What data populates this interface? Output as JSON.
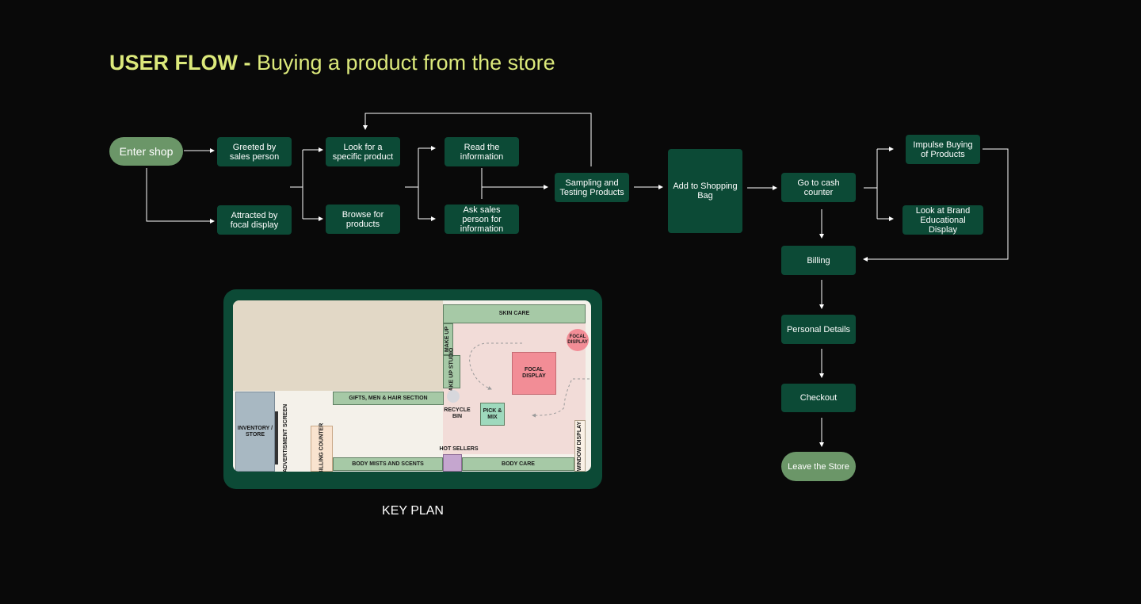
{
  "title": {
    "bold": "USER FLOW -",
    "rest": " Buying a product from the store"
  },
  "nodes": {
    "enter_shop": "Enter shop",
    "greeted": "Greeted by sales person",
    "attracted": "Attracted by focal display",
    "look_specific": "Look for a specific product",
    "browse": "Browse for products",
    "read_info": "Read the information",
    "ask_sales": "Ask sales person for information",
    "sampling": "Sampling and Testing Products",
    "add_bag": "Add to Shopping Bag",
    "cash_counter": "Go to cash counter",
    "impulse": "Impulse Buying of Products",
    "brand_display": "Look at Brand Educational Display",
    "billing": "Billing",
    "personal": "Personal Details",
    "checkout": "Checkout",
    "leave": "Leave the Store"
  },
  "keyplan": {
    "caption": "KEY PLAN",
    "skin_care": "SKIN CARE",
    "make_up": "MAKE UP",
    "make_up_studio": "MAKE UP STUDIO",
    "focal_display_small": "FOCAL DISPLAY",
    "focal_display": "FOCAL DISPLAY",
    "gifts": "GIFTS, MEN & HAIR SECTION",
    "recycle": "RECYCLE BIN",
    "pick_mix": "PICK & MIX",
    "inventory": "INVENTORY / STORE",
    "ad_screen": "ADVERTISMENT SCREEN",
    "billing_counter": "BILLING COUNTER",
    "hot_sellers": "HOT SELLERS",
    "window_display": "WINDOW DISPLAY",
    "body_mists": "BODY MISTS AND SCENTS",
    "body_care": "BODY CARE"
  },
  "colors": {
    "title": "#dce97b",
    "node": "#0c4a36",
    "pill": "#6b9668",
    "connector": "#ffffff"
  }
}
